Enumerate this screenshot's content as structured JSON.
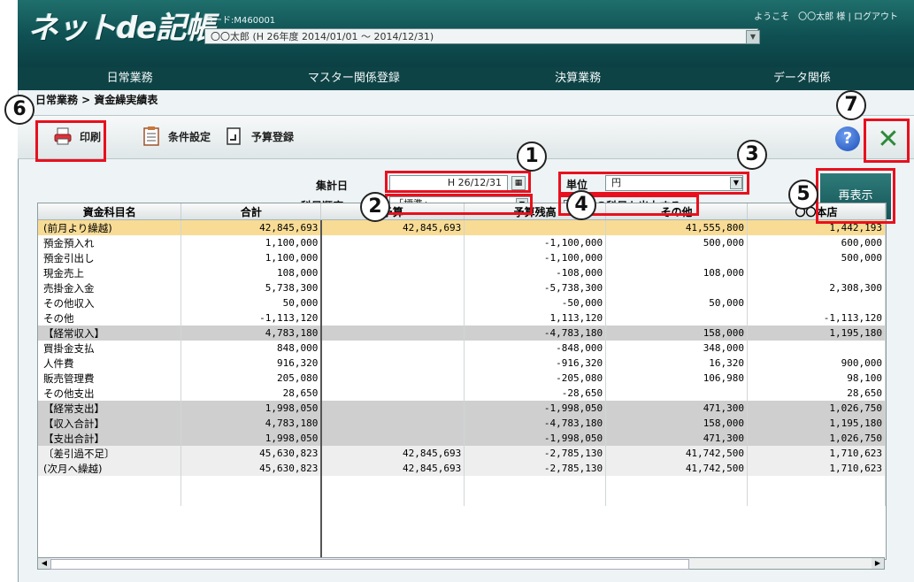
{
  "header": {
    "logo": "ネットde記帳",
    "code": "コード:M460001",
    "period": "〇〇太郎 (H 26年度 2014/01/01 ～ 2014/12/31)",
    "welcome": "ようこそ　〇〇太郎 様 | ログアウト"
  },
  "menu": [
    "日常業務",
    "マスター関係登録",
    "決算業務",
    "データ関係"
  ],
  "breadcrumb": "日常業務 > 資金繰実績表",
  "toolbar": {
    "print": "印刷",
    "conditions": "条件設定",
    "budget": "予算登録"
  },
  "form": {
    "date_label": "集計日",
    "date_value": "H 26/12/31",
    "order_label": "科目順序",
    "order_value": "「標準」",
    "unit_label": "単位",
    "unit_value": "円",
    "zero_label": "0円の科目も出力する",
    "redraw": "再表示"
  },
  "callouts": [
    "1",
    "2",
    "3",
    "4",
    "5",
    "6",
    "7"
  ],
  "table": {
    "headers": [
      "資金科目名",
      "合計",
      "予算",
      "予算残高",
      "その他",
      "〇〇本店"
    ],
    "rows": [
      {
        "style": "yellow",
        "cells": [
          "(前月より繰越)",
          "42,845,693",
          "42,845,693",
          "",
          "41,555,800",
          "1,442,193"
        ]
      },
      {
        "style": "",
        "cells": [
          "預金預入れ",
          "1,100,000",
          "",
          "-1,100,000",
          "500,000",
          "600,000"
        ]
      },
      {
        "style": "",
        "cells": [
          "預金引出し",
          "1,100,000",
          "",
          "-1,100,000",
          "",
          "500,000"
        ]
      },
      {
        "style": "",
        "cells": [
          "現金売上",
          "108,000",
          "",
          "-108,000",
          "108,000",
          ""
        ]
      },
      {
        "style": "",
        "cells": [
          "売掛金入金",
          "5,738,300",
          "",
          "-5,738,300",
          "",
          "2,308,300"
        ]
      },
      {
        "style": "",
        "cells": [
          "その他収入",
          "50,000",
          "",
          "-50,000",
          "50,000",
          ""
        ]
      },
      {
        "style": "",
        "cells": [
          "その他",
          "-1,113,120",
          "",
          "1,113,120",
          "",
          "-1,113,120"
        ]
      },
      {
        "style": "gray",
        "cells": [
          "【経常収入】",
          "4,783,180",
          "",
          "-4,783,180",
          "158,000",
          "1,195,180"
        ]
      },
      {
        "style": "",
        "cells": [
          "買掛金支払",
          "848,000",
          "",
          "-848,000",
          "348,000",
          ""
        ]
      },
      {
        "style": "",
        "cells": [
          "人件費",
          "916,320",
          "",
          "-916,320",
          "16,320",
          "900,000"
        ]
      },
      {
        "style": "",
        "cells": [
          "販売管理費",
          "205,080",
          "",
          "-205,080",
          "106,980",
          "98,100"
        ]
      },
      {
        "style": "",
        "cells": [
          "その他支出",
          "28,650",
          "",
          "-28,650",
          "",
          "28,650"
        ]
      },
      {
        "style": "gray",
        "cells": [
          "【経常支出】",
          "1,998,050",
          "",
          "-1,998,050",
          "471,300",
          "1,026,750"
        ]
      },
      {
        "style": "gray",
        "cells": [
          "【収入合計】",
          "4,783,180",
          "",
          "-4,783,180",
          "158,000",
          "1,195,180"
        ]
      },
      {
        "style": "gray",
        "cells": [
          "【支出合計】",
          "1,998,050",
          "",
          "-1,998,050",
          "471,300",
          "1,026,750"
        ]
      },
      {
        "style": "light",
        "cells": [
          "〔差引過不足〕",
          "45,630,823",
          "42,845,693",
          "-2,785,130",
          "41,742,500",
          "1,710,623"
        ]
      },
      {
        "style": "light",
        "cells": [
          "(次月へ繰越)",
          "45,630,823",
          "42,845,693",
          "-2,785,130",
          "41,742,500",
          "1,710,623"
        ]
      }
    ]
  }
}
